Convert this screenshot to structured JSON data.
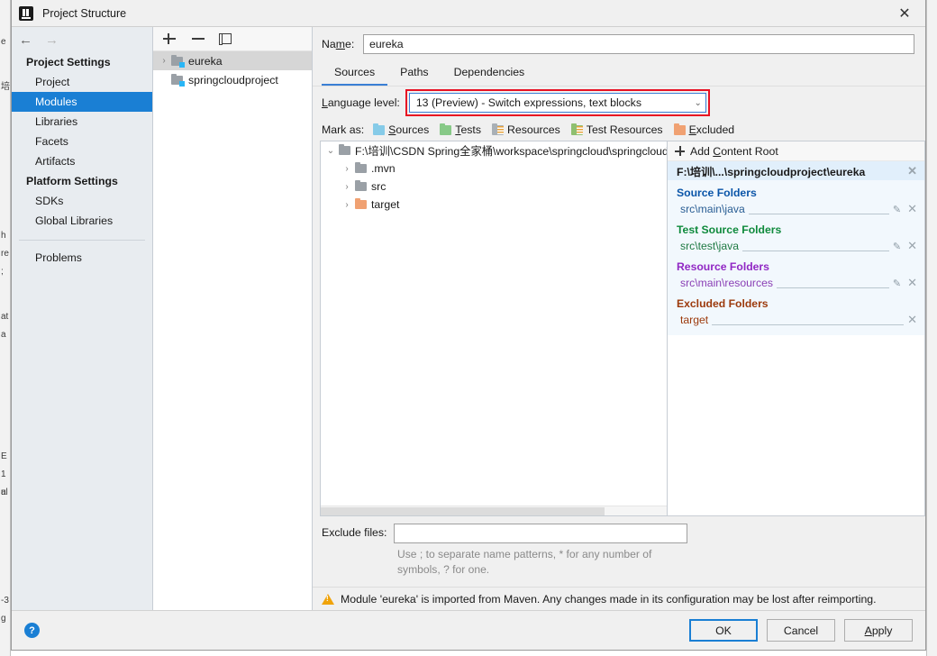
{
  "window": {
    "title": "Project Structure",
    "app_icon": "intellij-idea-icon",
    "close_label": "✕"
  },
  "background": {
    "left_fragments": [
      "e",
      "培",
      "h",
      "re",
      ";",
      "at",
      "a",
      "E",
      "1",
      "ul",
      "-3",
      "g",
      "a"
    ],
    "right_fragments": []
  },
  "nav": {
    "back_label": "←",
    "forward_label": "→",
    "groups": [
      {
        "title": "Project Settings",
        "items": [
          {
            "label": "Project",
            "selected": false
          },
          {
            "label": "Modules",
            "selected": true
          },
          {
            "label": "Libraries",
            "selected": false
          },
          {
            "label": "Facets",
            "selected": false
          },
          {
            "label": "Artifacts",
            "selected": false
          }
        ]
      },
      {
        "title": "Platform Settings",
        "items": [
          {
            "label": "SDKs",
            "selected": false
          },
          {
            "label": "Global Libraries",
            "selected": false
          }
        ]
      }
    ],
    "footer_items": [
      {
        "label": "Problems",
        "selected": false
      }
    ],
    "selection_color": "#1a7fd4"
  },
  "modules": {
    "toolbar": {
      "add_label": "+",
      "remove_label": "−",
      "copy_label": "copy-icon"
    },
    "items": [
      {
        "label": "eureka",
        "selected": true,
        "expandable": true,
        "arrow": "›"
      },
      {
        "label": "springcloudproject",
        "selected": false,
        "expandable": false,
        "arrow": ""
      }
    ]
  },
  "main": {
    "name_label": "Name:",
    "name_label_pre": "Na",
    "name_label_mnemonic": "m",
    "name_label_post": "e:",
    "name_value": "eureka",
    "tabs": [
      {
        "label": "Sources",
        "active": true
      },
      {
        "label": "Paths",
        "active": false
      },
      {
        "label": "Dependencies",
        "active": false
      }
    ],
    "language": {
      "label_pre": "",
      "label_mnemonic": "L",
      "label_post": "anguage level:",
      "value": "13 (Preview) - Switch expressions, text blocks",
      "chevron": "⌄",
      "highlight_color": "#e81123",
      "focus_border_color": "#3a7fd5"
    },
    "mark_as": {
      "label": "Mark as:",
      "options": [
        {
          "label_pre": "",
          "mnemonic": "S",
          "label_post": "ources",
          "color": "#86cbe8",
          "lines": false,
          "icon": "sources-folder-icon"
        },
        {
          "label_pre": "",
          "mnemonic": "T",
          "label_post": "ests",
          "color": "#87c987",
          "lines": false,
          "icon": "tests-folder-icon"
        },
        {
          "label_pre": "",
          "mnemonic": "R",
          "label_post": "esources",
          "color": "#a9b0b6",
          "lines": true,
          "icon": "resources-folder-icon"
        },
        {
          "label_pre": "Test ",
          "mnemonic": "R",
          "label_post": "esources",
          "color": "#8fbf6f",
          "lines": true,
          "icon": "test-resources-folder-icon"
        },
        {
          "label_pre": "",
          "mnemonic": "E",
          "label_post": "xcluded",
          "color": "#f0a172",
          "lines": false,
          "icon": "excluded-folder-icon"
        }
      ]
    },
    "tree": [
      {
        "label": "F:\\培训\\CSDN Spring全家桶\\workspace\\springcloud\\springcloudp",
        "indent": 0,
        "arrow": "⌄",
        "excluded": false
      },
      {
        "label": ".mvn",
        "indent": 1,
        "arrow": "›",
        "excluded": false
      },
      {
        "label": "src",
        "indent": 1,
        "arrow": "›",
        "excluded": false
      },
      {
        "label": "target",
        "indent": 1,
        "arrow": "›",
        "excluded": true
      }
    ],
    "content_root": {
      "add_label_pre": "Add ",
      "add_mnemonic": "C",
      "add_label_post": "ontent Root",
      "path": "F:\\培训\\...\\springcloudproject\\eureka",
      "close_label": "✕",
      "sections": [
        {
          "title": "Source Folders",
          "kind": "src",
          "color": "#0a55a8",
          "rows": [
            {
              "path": "src\\main\\java",
              "editable": true
            }
          ]
        },
        {
          "title": "Test Source Folders",
          "kind": "test",
          "color": "#0f8a3c",
          "rows": [
            {
              "path": "src\\test\\java",
              "editable": true
            }
          ]
        },
        {
          "title": "Resource Folders",
          "kind": "res",
          "color": "#9127c4",
          "rows": [
            {
              "path": "src\\main\\resources",
              "editable": true
            }
          ]
        },
        {
          "title": "Excluded Folders",
          "kind": "exc",
          "color": "#9c3a0c",
          "rows": [
            {
              "path": "target",
              "editable": false
            }
          ]
        }
      ],
      "pencil_label": "✎",
      "remove_label": "✕"
    },
    "exclude": {
      "label": "Exclude files:",
      "value": "",
      "hint": "Use ; to separate name patterns, * for any number of symbols, ? for one."
    },
    "warning": {
      "icon": "warning-triangle-icon",
      "text": "Module 'eureka' is imported from Maven. Any changes made in its configuration may be lost after reimporting."
    }
  },
  "footer": {
    "help_label": "?",
    "buttons": [
      {
        "label": "OK",
        "label_pre": "OK",
        "mnemonic": "",
        "label_post": "",
        "default": true
      },
      {
        "label": "Cancel",
        "label_pre": "Cancel",
        "mnemonic": "",
        "label_post": "",
        "default": false
      },
      {
        "label": "Apply",
        "label_pre": "",
        "mnemonic": "A",
        "label_post": "pply",
        "default": false
      }
    ]
  }
}
